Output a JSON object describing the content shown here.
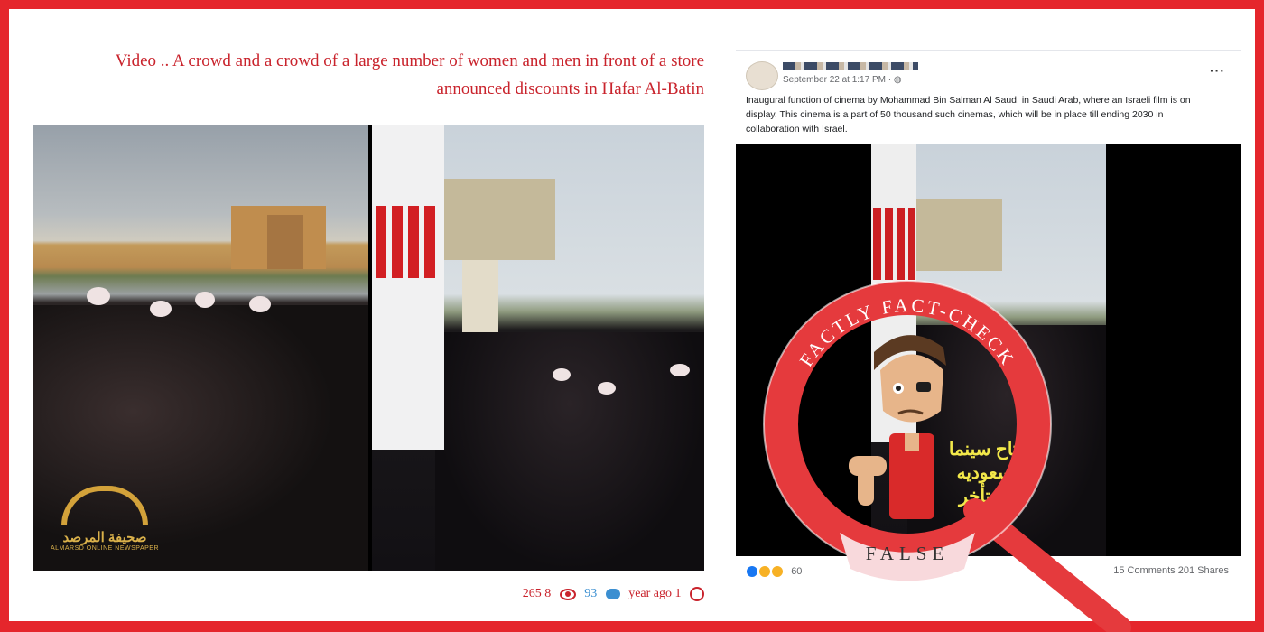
{
  "colors": {
    "accent_red": "#e5262c",
    "link_blue": "#3b8fd1",
    "stamp_red": "#e53a3d"
  },
  "article": {
    "title_line1": "Video .. A crowd and a crowd of a large number of women and men in front of a store",
    "title_line2": "announced discounts in Hafar Al-Batin",
    "logo_ar": "صحيفة المرصد",
    "logo_en": "ALMARSD ONLINE NEWSPAPER",
    "stats": {
      "views": "265 8",
      "comments": "93",
      "time": "year ago 1"
    }
  },
  "post": {
    "timestamp": "September 22 at 1:17 PM · ",
    "more_label": "···",
    "text": "Inaugural function of cinema by Mohammad Bin Salman Al Saud, in Saudi Arab, where an Israeli film is on display. This cinema is a  part of 50 thousand such  cinemas, which will be in place till ending 2030 in collaboration with Israel.",
    "video_overlay_line1": "افتتاح سينما",
    "video_overlay_line2": "بالسعوديه",
    "video_overlay_line3": "على تأخر",
    "reaction_count": "60",
    "comments_shares": "15 Comments  201 Shares"
  },
  "stamp": {
    "top_text": "FACTLY FACT-CHECK",
    "bottom_text": "FALSE"
  }
}
